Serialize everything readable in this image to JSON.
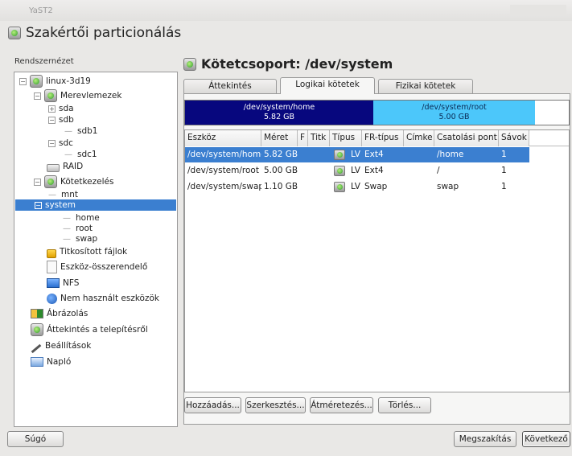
{
  "window": {
    "title": "YaST2"
  },
  "page": {
    "title": "Szakértői particionálás"
  },
  "left": {
    "label": "Rendszernézet",
    "tree": [
      {
        "id": "host",
        "label": "linux-3d19",
        "icon": "computer-icon",
        "expander": "−"
      },
      {
        "id": "hard-disks",
        "label": "Merevlemezek",
        "icon": "disk-icon",
        "expander": "−"
      },
      {
        "id": "sda",
        "label": "sda",
        "expander": "+"
      },
      {
        "id": "sdb",
        "label": "sdb",
        "expander": "−"
      },
      {
        "id": "sdb1",
        "label": "sdb1"
      },
      {
        "id": "sdc",
        "label": "sdc",
        "expander": "−"
      },
      {
        "id": "sdc1",
        "label": "sdc1"
      },
      {
        "id": "raid",
        "label": "RAID",
        "icon": "raid-icon"
      },
      {
        "id": "volume-management",
        "label": "Kötetkezelés",
        "icon": "volume-icon",
        "expander": "−"
      },
      {
        "id": "mnt",
        "label": "mnt"
      },
      {
        "id": "system",
        "label": "system",
        "expander": "−"
      },
      {
        "id": "home",
        "label": "home"
      },
      {
        "id": "root",
        "label": "root"
      },
      {
        "id": "swap",
        "label": "swap"
      },
      {
        "id": "crypt-files",
        "label": "Titkosított fájlok",
        "icon": "lock-icon"
      },
      {
        "id": "device-mapper",
        "label": "Eszköz-összerendelő",
        "icon": "device-mapper-icon"
      },
      {
        "id": "nfs",
        "label": "NFS",
        "icon": "network-folder-icon"
      },
      {
        "id": "unused-devices",
        "label": "Nem használt eszközök",
        "icon": "help-disk-icon"
      },
      {
        "id": "graph",
        "label": "Ábrázolás",
        "icon": "graph-icon"
      },
      {
        "id": "install-overview",
        "label": "Áttekintés a telepítésről",
        "icon": "disk-icon"
      },
      {
        "id": "settings",
        "label": "Beállítások",
        "icon": "wrench-icon"
      },
      {
        "id": "log",
        "label": "Napló",
        "icon": "log-icon"
      }
    ]
  },
  "right": {
    "title": "Kötetcsoport: /dev/system",
    "tabs": [
      {
        "label": "Áttekintés",
        "active": false
      },
      {
        "label": "Logikai kötetek",
        "active": true
      },
      {
        "label": "Fizikai kötetek",
        "active": false
      }
    ],
    "usage_bar": [
      {
        "name": "/dev/system/home",
        "size": "5.82 GB",
        "color": "#07077e"
      },
      {
        "name": "/dev/system/root",
        "size": "5.00 GB",
        "color": "#4cc7fa"
      }
    ],
    "table": {
      "headers": [
        "Eszköz",
        "Méret",
        "F",
        "Titk",
        "Típus",
        "FR-típus",
        "Címke",
        "Csatolási pont",
        "Sávok"
      ],
      "rows": [
        {
          "device": "/dev/system/home",
          "size": "5.82 GB",
          "f": "",
          "crypt": "",
          "type": "LV",
          "fs": "Ext4",
          "label": "",
          "mount": "/home",
          "stripes": "1",
          "selected": true
        },
        {
          "device": "/dev/system/root",
          "size": "5.00 GB",
          "f": "",
          "crypt": "",
          "type": "LV",
          "fs": "Ext4",
          "label": "",
          "mount": "/",
          "stripes": "1",
          "selected": false
        },
        {
          "device": "/dev/system/swap",
          "size": "1.10 GB",
          "f": "",
          "crypt": "",
          "type": "LV",
          "fs": "Swap",
          "label": "",
          "mount": "swap",
          "stripes": "1",
          "selected": false
        }
      ]
    },
    "buttons": {
      "add": "Hozzáadás...",
      "edit": "Szerkesztés...",
      "resize": "Átméretezés...",
      "delete": "Törlés..."
    }
  },
  "footer": {
    "help": "Súgó",
    "abort": "Megszakítás",
    "next": "Következő"
  },
  "colors": {
    "selection": "#3b7fd0",
    "home_segment": "#07077e",
    "root_segment": "#4cc7fa"
  }
}
